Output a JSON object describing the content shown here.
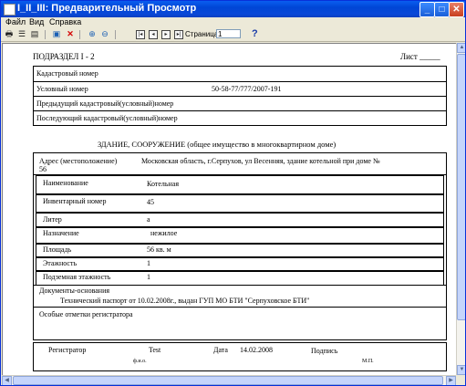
{
  "window": {
    "title": "I_II_III: Предварительный Просмотр",
    "minimize": "_",
    "maximize": "□",
    "close": "✕"
  },
  "menu": [
    "Файл",
    "Вид",
    "Справка"
  ],
  "toolbar": {
    "icons": [
      "print-icon",
      "print-setup-icon",
      "export-icon",
      "zoom-fit-icon",
      "close-red-x-icon",
      "zoom-in-icon",
      "zoom-out-icon",
      "first-page-icon",
      "prev-page-icon",
      "next-page-icon",
      "last-page-icon",
      "help-icon"
    ],
    "page_label": "Страница:",
    "page_value": "1",
    "help_label": "?"
  },
  "document": {
    "section": "ПОДРАЗДЕЛ I - 2",
    "sheet": "Лист _____",
    "cadastral_rows": [
      {
        "label": "Кадастровый номер",
        "value": ""
      },
      {
        "label": "Условный номер",
        "value": "50-58-77/777/2007-191"
      },
      {
        "label": "Предыдущий кадастровый(условный)номер",
        "value": ""
      },
      {
        "label": "Последующий кадастровый(условный)номер",
        "value": ""
      }
    ],
    "building_title": "ЗДАНИЕ, СООРУЖЕНИЕ  (общее имущество в многоквартирном доме)",
    "address_label": "Адрес (местоположение)",
    "address_value": "Московская область, г.Серпухов, ул Весенняя, здание котельной при доме №",
    "address_value2": "56",
    "fields": [
      {
        "label": "Наименование",
        "value": "Котельная"
      },
      {
        "label": "Инвентарный номер",
        "value": "45"
      },
      {
        "label": "Литер",
        "value": "а"
      },
      {
        "label": "Назначение",
        "value": "нежилое"
      },
      {
        "label": "Площадь",
        "value": "56 кв. м"
      },
      {
        "label": "Этажность",
        "value": "1"
      },
      {
        "label": "Подземная этажность",
        "value": "1"
      }
    ],
    "documents_label": "Документы-основания",
    "documents_value": "Технический паспорт от 10.02.2008г., выдан ГУП МО БТИ \"Серпуховское БТИ\"",
    "notes_label": "Особые отметки регистратора",
    "registrar_label": "Регистратор",
    "registrar_value": "Test",
    "date_label": "Дата",
    "date_value": "14.02.2008",
    "signature_label": "Подпись",
    "fio_label": "ф.и.о.",
    "mp_label": "М.П."
  }
}
